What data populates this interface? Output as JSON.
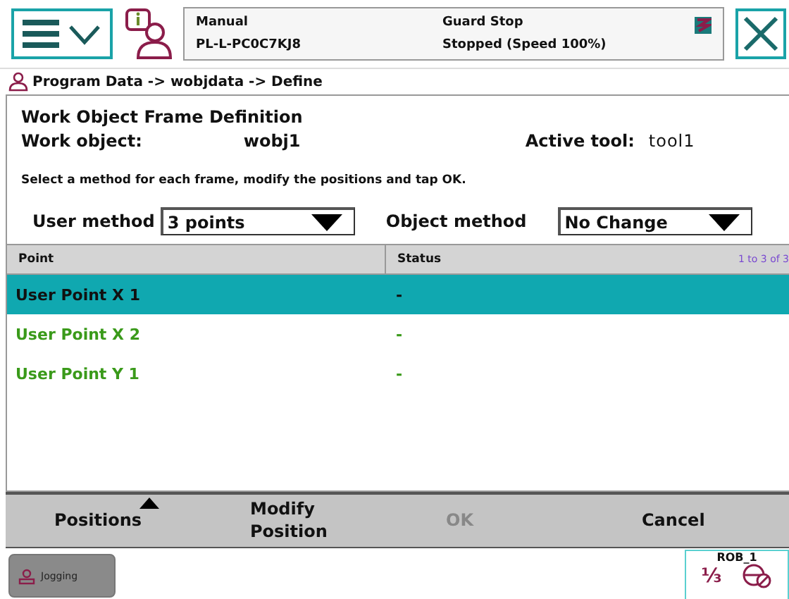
{
  "status": {
    "mode": "Manual",
    "controller": "PL-L-PC0C7KJ8",
    "state": "Guard Stop",
    "speed": "Stopped (Speed 100%)"
  },
  "breadcrumb": "Program Data -> wobjdata -> Define",
  "title": "Work Object Frame Definition",
  "work_object": {
    "label": "Work object:",
    "value": "wobj1"
  },
  "active_tool": {
    "label": "Active tool:",
    "value": "tool1"
  },
  "instruction": "Select a method for each frame, modify the positions and tap OK.",
  "user_method": {
    "label": "User method",
    "value": "3 points"
  },
  "object_method": {
    "label": "Object method",
    "value": "No Change"
  },
  "table": {
    "columns": [
      "Point",
      "Status"
    ],
    "range": "1 to 3 of 3",
    "rows": [
      {
        "point": "User Point X 1",
        "status": "-",
        "selected": true
      },
      {
        "point": "User Point X 2",
        "status": "-",
        "selected": false
      },
      {
        "point": "User Point Y 1",
        "status": "-",
        "selected": false
      }
    ]
  },
  "toolbar": [
    {
      "label": "Positions",
      "kind": "menu",
      "disabled": false
    },
    {
      "label": "Modify Position",
      "kind": "button",
      "disabled": false
    },
    {
      "label": "OK",
      "kind": "button",
      "disabled": true
    },
    {
      "label": "Cancel",
      "kind": "button",
      "disabled": false
    }
  ],
  "taskbar": {
    "app": "Jogging",
    "robot": "ROB_1",
    "fraction": "⅓"
  }
}
